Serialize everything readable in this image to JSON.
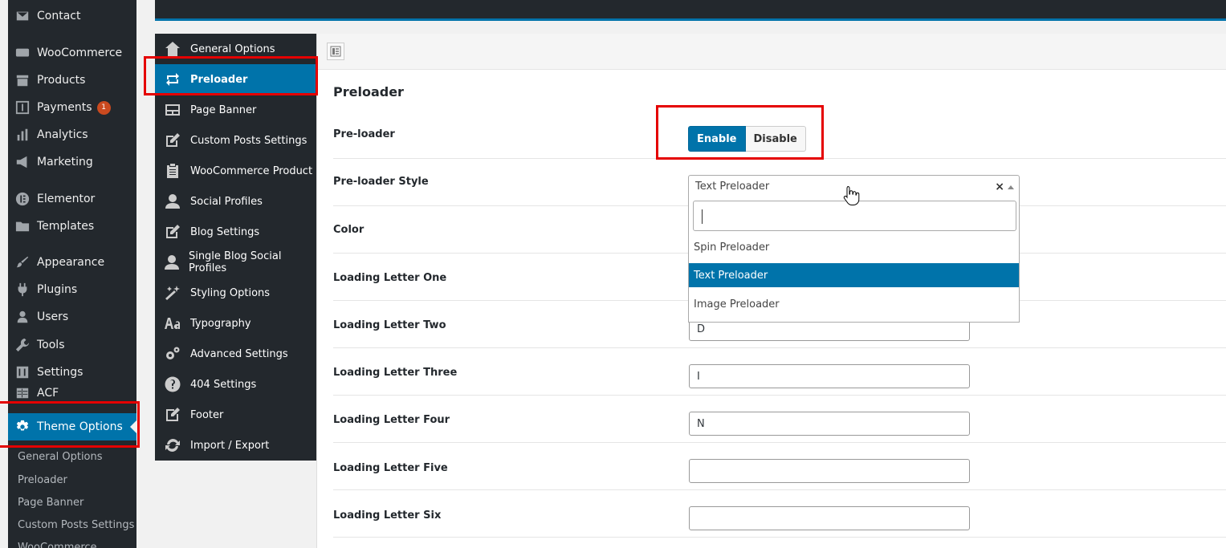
{
  "wp_menu": {
    "items": [
      {
        "label": "Contact",
        "icon": "mail-icon"
      },
      {
        "label": "WooCommerce",
        "icon": "woo-icon"
      },
      {
        "label": "Products",
        "icon": "archive-icon"
      },
      {
        "label": "Payments",
        "icon": "dollar-icon",
        "badge": "1"
      },
      {
        "label": "Analytics",
        "icon": "bar-chart-icon"
      },
      {
        "label": "Marketing",
        "icon": "megaphone-icon"
      },
      {
        "label": "Elementor",
        "icon": "elementor-icon"
      },
      {
        "label": "Templates",
        "icon": "folder-icon"
      },
      {
        "label": "Appearance",
        "icon": "brush-icon"
      },
      {
        "label": "Plugins",
        "icon": "plug-icon"
      },
      {
        "label": "Users",
        "icon": "user-icon"
      },
      {
        "label": "Tools",
        "icon": "wrench-icon"
      },
      {
        "label": "Settings",
        "icon": "sliders-icon"
      },
      {
        "label": "ACF",
        "icon": "table-icon"
      },
      {
        "label": "Theme Options",
        "icon": "gear-icon"
      }
    ],
    "submenu": [
      "General Options",
      "Preloader",
      "Page Banner",
      "Custom Posts Settings",
      "WooCommerce"
    ]
  },
  "options_nav": {
    "items": [
      {
        "label": "General Options",
        "icon": "home-icon"
      },
      {
        "label": "Preloader",
        "icon": "repeat-icon"
      },
      {
        "label": "Page Banner",
        "icon": "banner-icon"
      },
      {
        "label": "Custom Posts Settings",
        "icon": "edit-icon"
      },
      {
        "label": "WooCommerce Product",
        "icon": "clipboard-icon"
      },
      {
        "label": "Social Profiles",
        "icon": "person-icon"
      },
      {
        "label": "Blog Settings",
        "icon": "edit-icon"
      },
      {
        "label": "Single Blog Social Profiles",
        "icon": "person-icon"
      },
      {
        "label": "Styling Options",
        "icon": "magic-wand-icon"
      },
      {
        "label": "Typography",
        "icon": "typography-icon"
      },
      {
        "label": "Advanced Settings",
        "icon": "cogs-icon"
      },
      {
        "label": "404 Settings",
        "icon": "question-icon"
      },
      {
        "label": "Footer",
        "icon": "edit-square-icon"
      },
      {
        "label": "Import / Export",
        "icon": "refresh-icon"
      }
    ]
  },
  "section": {
    "title": "Preloader",
    "preloader_label": "Pre-loader",
    "enable_label": "Enable",
    "disable_label": "Disable",
    "style_label": "Pre-loader Style",
    "style_selected": "Text Preloader",
    "style_clear": "×",
    "style_options": [
      "Spin Preloader",
      "Text Preloader",
      "Image Preloader"
    ],
    "color_label": "Color",
    "letters": [
      {
        "label": "Loading Letter One",
        "value": ""
      },
      {
        "label": "Loading Letter Two",
        "value": "D"
      },
      {
        "label": "Loading Letter Three",
        "value": "I"
      },
      {
        "label": "Loading Letter Four",
        "value": "N"
      },
      {
        "label": "Loading Letter Five",
        "value": ""
      },
      {
        "label": "Loading Letter Six",
        "value": ""
      }
    ]
  },
  "colors": {
    "accent": "#0073aa",
    "sidebar_bg": "#23282d",
    "highlight": "#e50000"
  }
}
